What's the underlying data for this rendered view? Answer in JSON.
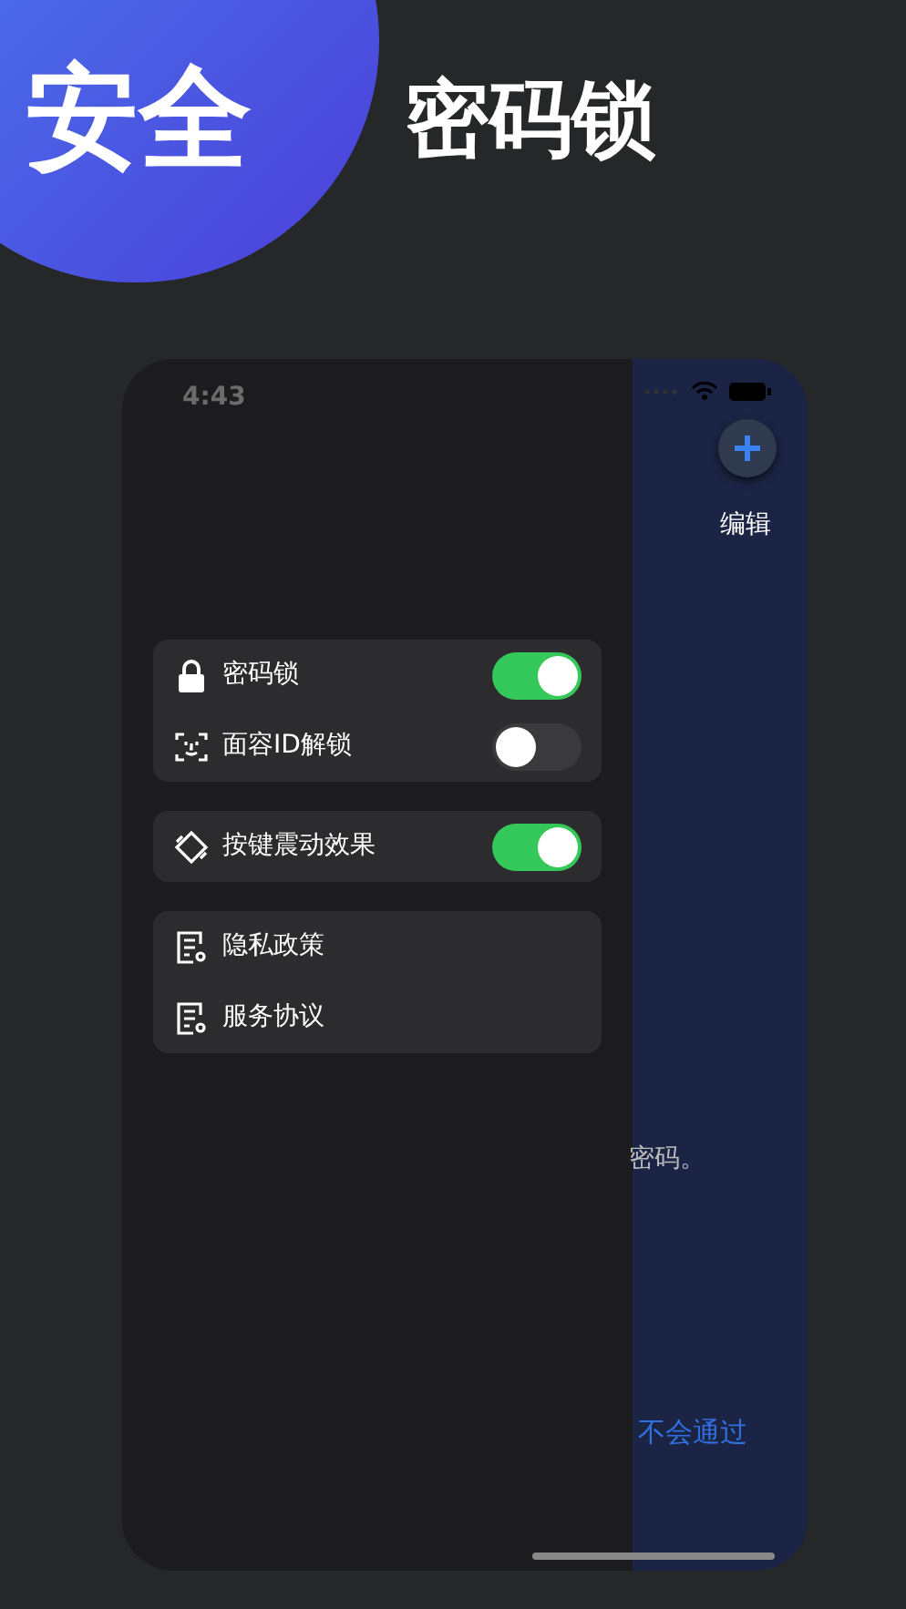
{
  "banner": {
    "badge": "安全",
    "title": "密码锁"
  },
  "phone": {
    "status_bar": {
      "time": "4:43"
    },
    "drawer": {
      "groups": [
        {
          "items": [
            {
              "kind": "toggle",
              "label": "密码锁",
              "on": true
            },
            {
              "kind": "toggle",
              "label": "面容ID解锁",
              "on": false
            }
          ]
        },
        {
          "items": [
            {
              "kind": "toggle",
              "label": "按键震动效果",
              "on": true
            }
          ]
        },
        {
          "items": [
            {
              "kind": "link",
              "label": "隐私政策"
            },
            {
              "kind": "link",
              "label": "服务协议"
            }
          ]
        }
      ]
    },
    "main": {
      "edit_button": "编辑",
      "hint_text": "密码。",
      "link_text": "不会通过"
    }
  }
}
